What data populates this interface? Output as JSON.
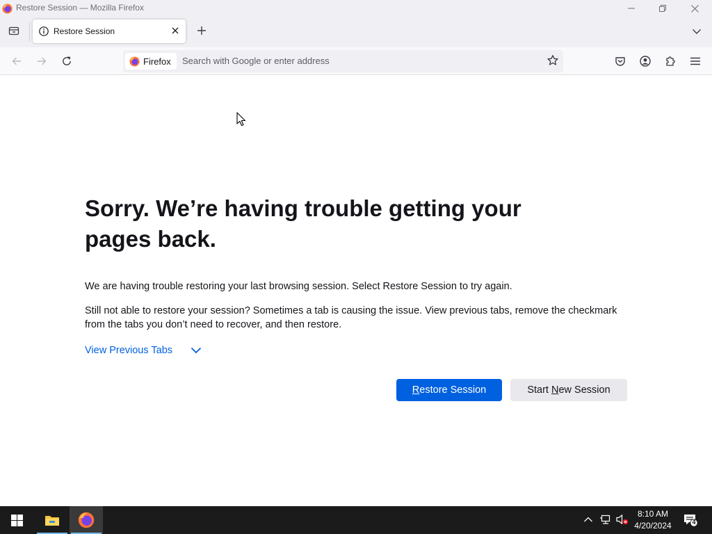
{
  "window": {
    "title": "Restore Session — Mozilla Firefox"
  },
  "tabs": [
    {
      "label": "Restore Session"
    }
  ],
  "urlbar": {
    "identity_label": "Firefox",
    "placeholder": "Search with Google or enter address"
  },
  "page": {
    "heading": "Sorry. We’re having trouble getting your pages back.",
    "para1": "We are having trouble restoring your last browsing session. Select Restore Session to try again.",
    "para2": "Still not able to restore your session? Sometimes a tab is causing the issue. View previous tabs, remove the checkmark from the tabs you don’t need to recover, and then restore.",
    "view_previous": "View Previous Tabs",
    "restore_btn": {
      "accesskey": "R",
      "rest": "estore Session"
    },
    "new_session_btn": {
      "before": "Start ",
      "accesskey": "N",
      "rest": "ew Session"
    }
  },
  "taskbar": {
    "time": "8:10 AM",
    "date": "4/20/2024",
    "notification_count": "4"
  },
  "colors": {
    "accent": "#0061e0",
    "link": "#0060df",
    "toolbar": "#f0f0f4"
  }
}
